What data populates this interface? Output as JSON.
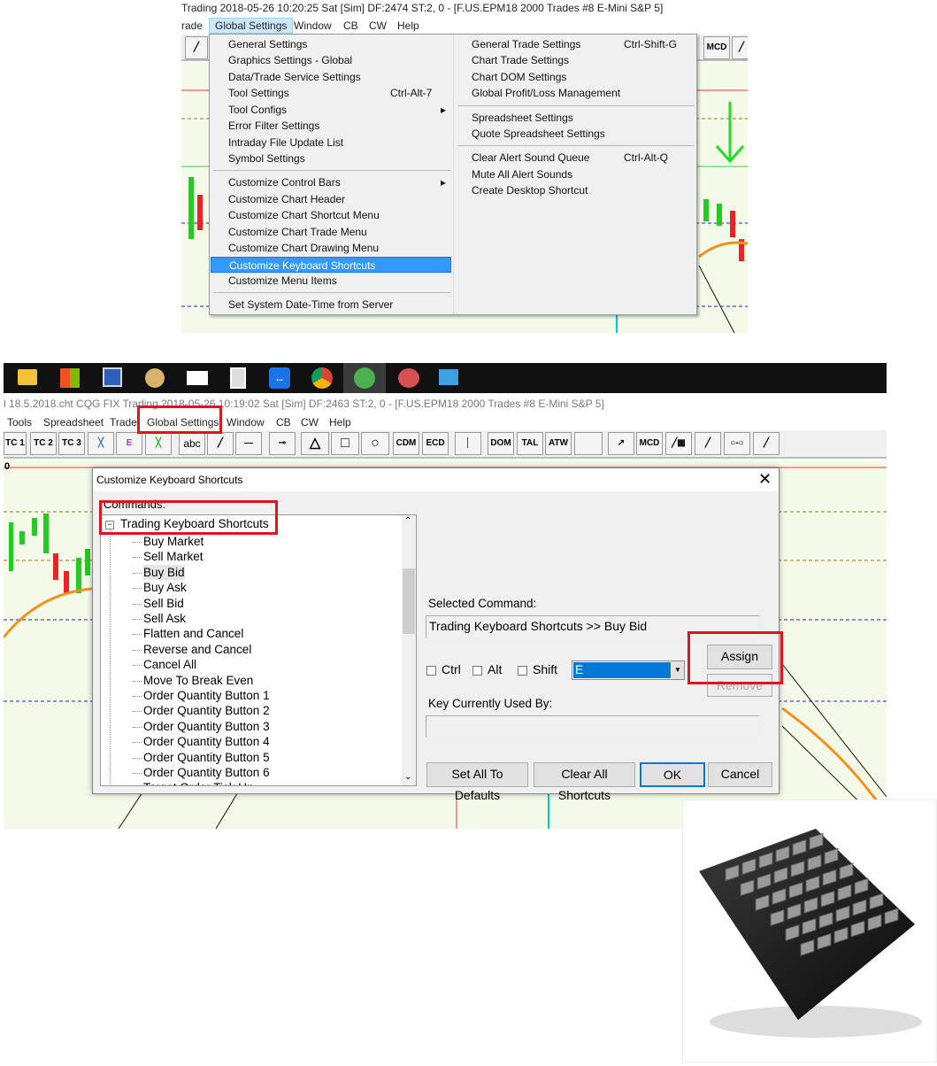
{
  "top": {
    "title": "Trading 2018-05-26  10:20:25 Sat [Sim]  DF:2474  ST:2, 0 - [F.US.EPM18  2000 Trades  #8  E-Mini S&P 5]",
    "menus": [
      "rade",
      "Global Settings",
      "Window",
      "CB",
      "CW",
      "Help"
    ],
    "toolbar_labels": {
      "mcd": "MCD"
    },
    "dropdown_left": [
      {
        "label": "General Settings",
        "shortcut": ""
      },
      {
        "label": "Graphics Settings - Global",
        "shortcut": ""
      },
      {
        "label": "Data/Trade Service Settings",
        "shortcut": ""
      },
      {
        "label": "Tool Settings",
        "shortcut": "Ctrl-Alt-7"
      },
      {
        "label": "Tool Configs",
        "shortcut": "▸"
      },
      {
        "label": "Error Filter Settings",
        "shortcut": ""
      },
      {
        "label": "Intraday File Update List",
        "shortcut": ""
      },
      {
        "label": "Symbol Settings",
        "shortcut": ""
      },
      {
        "label": "Customize Control Bars",
        "shortcut": "▸"
      },
      {
        "label": "Customize Chart Header",
        "shortcut": ""
      },
      {
        "label": "Customize Chart Shortcut Menu",
        "shortcut": ""
      },
      {
        "label": "Customize Chart Trade Menu",
        "shortcut": ""
      },
      {
        "label": "Customize Chart Drawing Menu",
        "shortcut": ""
      },
      {
        "label": "Customize Keyboard Shortcuts",
        "shortcut": ""
      },
      {
        "label": "Customize Menu Items",
        "shortcut": ""
      },
      {
        "label": "Set System Date-Time from Server",
        "shortcut": ""
      }
    ],
    "dropdown_right": [
      {
        "label": "General Trade Settings",
        "shortcut": "Ctrl-Shift-G"
      },
      {
        "label": "Chart Trade Settings",
        "shortcut": ""
      },
      {
        "label": "Chart DOM Settings",
        "shortcut": ""
      },
      {
        "label": "Global Profit/Loss Management",
        "shortcut": ""
      },
      {
        "label": "Spreadsheet Settings",
        "shortcut": ""
      },
      {
        "label": "Quote Spreadsheet Settings",
        "shortcut": ""
      },
      {
        "label": "Clear Alert Sound Queue",
        "shortcut": "Ctrl-Alt-Q"
      },
      {
        "label": "Mute All Alert Sounds",
        "shortcut": ""
      },
      {
        "label": "Create Desktop Shortcut",
        "shortcut": ""
      }
    ]
  },
  "bottom": {
    "title": "l 18.5.2018.cht  CQG FIX Trading 2018-05-26  10:19:02 Sat [Sim]  DF:2463  ST:2, 0 - [F.US.EPM18  2000 Trades  #8  E-Mini S&P 5]",
    "menus": [
      "Tools",
      "Spreadsheet",
      "Trade",
      "Global Settings",
      "Window",
      "CB",
      "CW",
      "Help"
    ],
    "toolbar": [
      "TC 1",
      "TC 2",
      "TC 3",
      "abc",
      "CDM",
      "ECD",
      "DOM",
      "TAL",
      "ATW",
      "MCD"
    ],
    "chart_axis_label": "0"
  },
  "dialog": {
    "title": "Customize Keyboard Shortcuts",
    "commands_label": "Commands:",
    "tree_root": "Trading Keyboard Shortcuts",
    "tree_items": [
      "Buy Market",
      "Sell Market",
      "Buy Bid",
      "Buy Ask",
      "Sell Bid",
      "Sell Ask",
      "Flatten and Cancel",
      "Reverse and Cancel",
      "Cancel All",
      "Move To Break Even",
      "Order Quantity Button 1",
      "Order Quantity Button 2",
      "Order Quantity Button 3",
      "Order Quantity Button 4",
      "Order Quantity Button 5",
      "Order Quantity Button 6",
      "Target Order Tick Up"
    ],
    "selected_command_label": "Selected Command:",
    "selected_command_value": "Trading Keyboard Shortcuts >> Buy Bid",
    "ctrl": "Ctrl",
    "alt": "Alt",
    "shift": "Shift",
    "key_value": "E",
    "assign": "Assign",
    "remove": "Remove",
    "key_used_label": "Key Currently Used By:",
    "key_used_value": "",
    "set_defaults": "Set All To Defaults",
    "clear_all": "Clear All Shortcuts",
    "ok": "OK",
    "cancel": "Cancel"
  },
  "colors": {
    "highlight": "#3399ff",
    "callout": "#e0141e",
    "chart_bg": "#f3fbe8"
  }
}
